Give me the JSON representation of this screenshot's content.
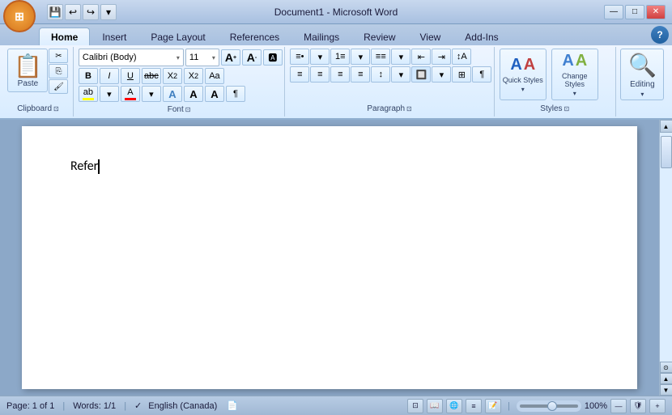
{
  "titlebar": {
    "title": "Document1 - Microsoft Word",
    "quick_access": [
      "💾",
      "↩",
      "↪"
    ],
    "window_controls": [
      "—",
      "□",
      "✕"
    ]
  },
  "tabs": {
    "items": [
      "Home",
      "Insert",
      "Page Layout",
      "References",
      "Mailings",
      "Review",
      "View",
      "Add-Ins"
    ],
    "active": "Home"
  },
  "ribbon": {
    "groups": [
      {
        "name": "Clipboard",
        "label": "Clipboard"
      },
      {
        "name": "Font",
        "label": "Font"
      },
      {
        "name": "Paragraph",
        "label": "Paragraph"
      },
      {
        "name": "Styles",
        "label": "Styles"
      },
      {
        "name": "Editing",
        "label": ""
      }
    ],
    "font": {
      "name": "Calibri (Body)",
      "size": "11",
      "bold": "B",
      "italic": "I",
      "underline": "U"
    },
    "styles": {
      "quick_label": "Quick Styles",
      "change_label": "Change Styles",
      "editing_label": "Editing"
    }
  },
  "document": {
    "text": "Refer",
    "cursor_visible": true
  },
  "status_bar": {
    "page": "Page: 1 of 1",
    "words": "Words: 1/1",
    "language": "English (Canada)",
    "zoom": "100%",
    "zoom_in": "+",
    "zoom_out": "—"
  }
}
